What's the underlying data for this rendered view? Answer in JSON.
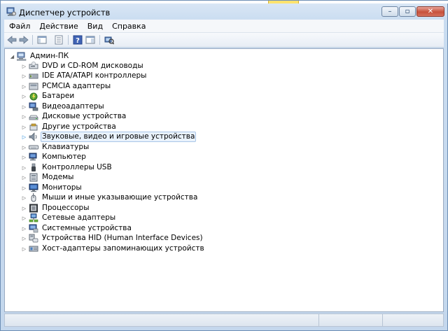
{
  "window": {
    "title": "Диспетчер устройств",
    "menu": [
      "Файл",
      "Действие",
      "Вид",
      "Справка"
    ]
  },
  "toolbar": {
    "icons": [
      "back-arrow-icon",
      "forward-arrow-icon",
      "properties-icon",
      "show-hide-console-tree-icon",
      "help-icon",
      "show-action-pane-icon",
      "scan-hardware-icon"
    ]
  },
  "tree": {
    "root": {
      "label": "Админ-ПК",
      "icon": "computer-icon",
      "expanded": true
    },
    "items": [
      {
        "label": "DVD и CD-ROM дисководы",
        "icon": "dvd-drive-icon"
      },
      {
        "label": "IDE ATA/ATAPI контроллеры",
        "icon": "ide-controller-icon"
      },
      {
        "label": "PCMCIA адаптеры",
        "icon": "pcmcia-adapter-icon"
      },
      {
        "label": "Батареи",
        "icon": "battery-icon"
      },
      {
        "label": "Видеоадаптеры",
        "icon": "display-adapter-icon"
      },
      {
        "label": "Дисковые устройства",
        "icon": "disk-drive-icon"
      },
      {
        "label": "Другие устройства",
        "icon": "other-devices-icon"
      },
      {
        "label": "Звуковые, видео и игровые устройства",
        "icon": "sound-icon",
        "selected": true
      },
      {
        "label": "Клавиатуры",
        "icon": "keyboard-icon"
      },
      {
        "label": "Компьютер",
        "icon": "computer-monitor-icon"
      },
      {
        "label": "Контроллеры USB",
        "icon": "usb-icon"
      },
      {
        "label": "Модемы",
        "icon": "modem-icon"
      },
      {
        "label": "Мониторы",
        "icon": "monitor-icon"
      },
      {
        "label": "Мыши и иные указывающие устройства",
        "icon": "mouse-icon"
      },
      {
        "label": "Процессоры",
        "icon": "processor-icon"
      },
      {
        "label": "Сетевые адаптеры",
        "icon": "network-adapter-icon"
      },
      {
        "label": "Системные устройства",
        "icon": "system-devices-icon"
      },
      {
        "label": "Устройства HID (Human Interface Devices)",
        "icon": "hid-icon"
      },
      {
        "label": "Хост-адаптеры запоминающих устройств",
        "icon": "storage-controller-icon"
      }
    ]
  },
  "colors": {
    "selection_border": "#a9c6e8",
    "selection_fill": "#e9f2fc",
    "frame": "#c4d7ed",
    "close_button": "#c7503b"
  }
}
